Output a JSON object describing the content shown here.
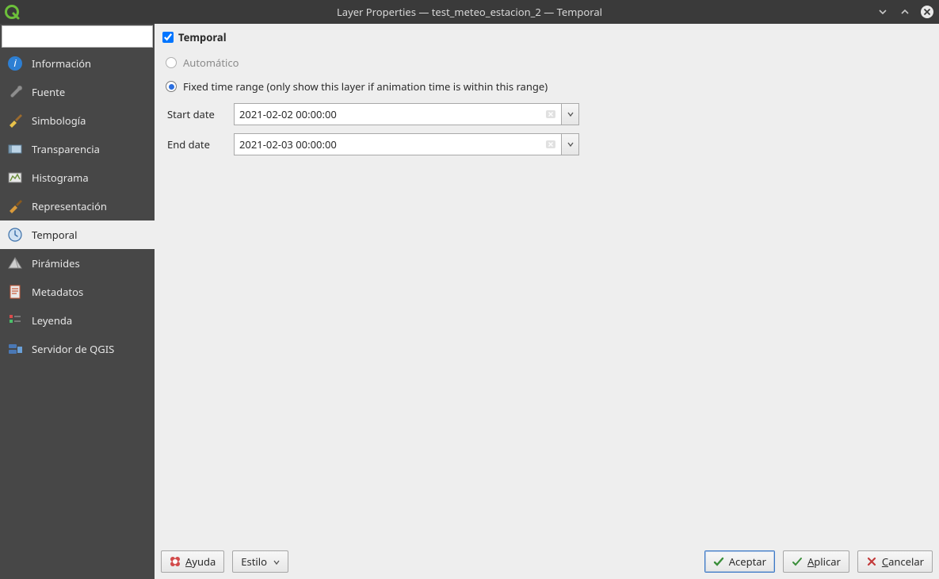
{
  "window": {
    "title": "Layer Properties — test_meteo_estacion_2 — Temporal"
  },
  "search": {
    "placeholder": ""
  },
  "sidebar": {
    "items": [
      {
        "label": "Información"
      },
      {
        "label": "Fuente"
      },
      {
        "label": "Simbología"
      },
      {
        "label": "Transparencia"
      },
      {
        "label": "Histograma"
      },
      {
        "label": "Representación"
      },
      {
        "label": "Temporal"
      },
      {
        "label": "Pirámides"
      },
      {
        "label": "Metadatos"
      },
      {
        "label": "Leyenda"
      },
      {
        "label": "Servidor de QGIS"
      }
    ],
    "selected_index": 6
  },
  "panel": {
    "header_label": "Temporal",
    "header_checked": true,
    "options": {
      "automatic": {
        "label": "Automático",
        "checked": false,
        "disabled": true
      },
      "fixed": {
        "label": "Fixed time range (only show this layer if animation time is within this range)",
        "checked": true
      }
    },
    "fields": {
      "start": {
        "label": "Start date",
        "value": "2021-02-02 00:00:00"
      },
      "end": {
        "label": "End date",
        "value": "2021-02-03 00:00:00"
      }
    }
  },
  "buttons": {
    "help": "Ayuda",
    "style": "Estilo",
    "ok": "Aceptar",
    "apply": "Aplicar",
    "cancel": "Cancelar"
  }
}
